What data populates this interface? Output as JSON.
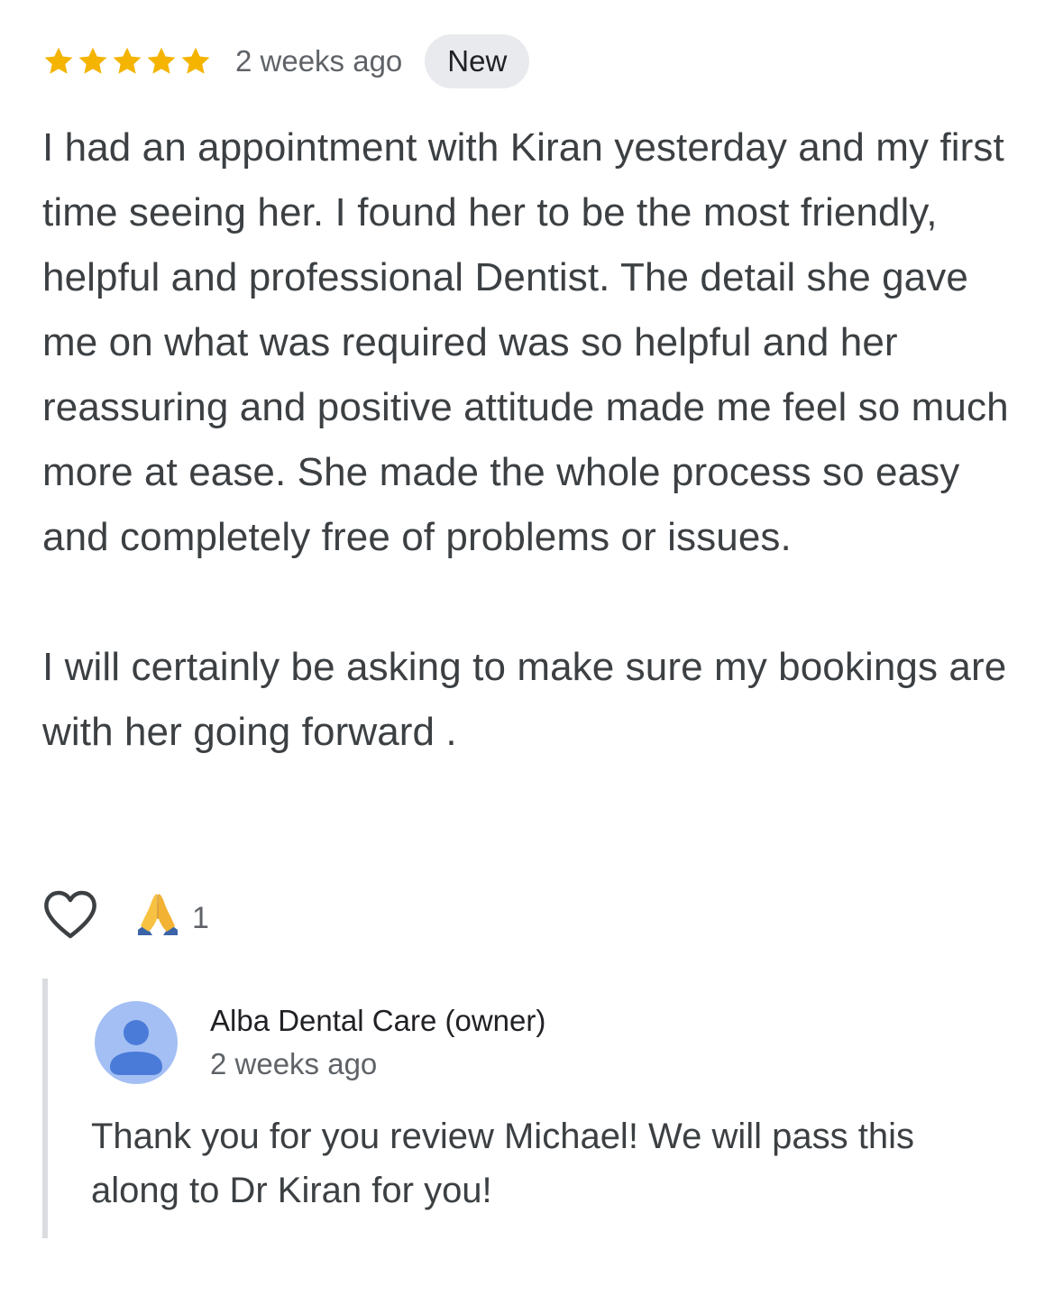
{
  "review": {
    "rating": 5,
    "rating_max": 5,
    "star_color": "#F4B400",
    "time": "2 weeks ago",
    "badge": "New",
    "text": "I had an appointment with Kiran yesterday and my first time seeing her. I found her to be the most friendly, helpful and professional Dentist. The detail she gave me on what was required was so helpful and her reassuring and positive attitude made me feel so much more at ease. She made the whole process so easy and completely free of problems or issues.\n\nI will certainly be asking to make sure my bookings are with her going forward ."
  },
  "actions": {
    "like_icon": "heart-outline-icon",
    "reaction_icon": "folded-hands-emoji",
    "reaction_count": "1"
  },
  "reply": {
    "owner": "Alba Dental Care (owner)",
    "time": "2 weeks ago",
    "avatar_icon": "person-avatar-icon",
    "avatar_bg": "#A3BFF4",
    "avatar_fg": "#4A7BD8",
    "text": "Thank you for you review Michael! We will pass this along to Dr Kiran for you!"
  }
}
